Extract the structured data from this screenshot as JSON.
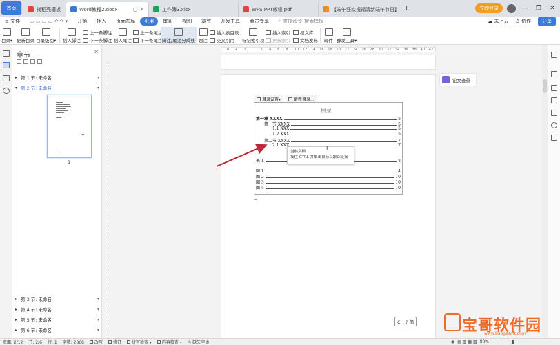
{
  "titlebar": {
    "home_label": "首页",
    "tabs": [
      {
        "label": "找稻壳模板",
        "icon_color": "#e0483a"
      },
      {
        "label": "Word教程2.docx",
        "icon_color": "#3d7bd9"
      },
      {
        "label": "工作簿3.xlsx",
        "icon_color": "#22a15c"
      },
      {
        "label": "WPS PPT教程.pdf",
        "icon_color": "#e0483a"
      },
      {
        "label": "【端午狂欢祝福清新端午节日】",
        "icon_color": "#f08a2a"
      }
    ],
    "new_tab": "+",
    "vip_label": "立即登录",
    "window_controls": [
      "—",
      "❐",
      "✕"
    ]
  },
  "menubar": {
    "file_label": "文件",
    "items": [
      "开始",
      "插入",
      "页面布局",
      "引用",
      "审阅",
      "视图",
      "章节",
      "开发工具",
      "会员专享"
    ],
    "active_item": "引用",
    "search_label": "查找命令",
    "search_template": "搜索模板",
    "right_items": [
      "未上云",
      "协作"
    ],
    "share_label": "分享"
  },
  "ribbon": {
    "toc_label": "目录▾",
    "update_toc": "更新目录",
    "toc_level": "目录级别▾",
    "insert_footnote": "插入脚注",
    "prev_footnote": "上一条脚注",
    "next_footnote": "下一条脚注",
    "insert_endnote": "插入尾注",
    "prev_endnote": "上一条尾注",
    "next_endnote": "下一条尾注",
    "footnote_sep": "脚注/尾注分隔线",
    "caption": "题注",
    "insert_table_toc": "插入表目录",
    "cross_ref": "交叉引用",
    "mark_index": "标记索引项",
    "insert_index": "插入索引",
    "update_index": "更新索引",
    "search_lib": "搜文库",
    "doc_publish": "文档发布",
    "mail": "邮件",
    "mass_tool": "群发工具▾"
  },
  "panel": {
    "title": "章节",
    "sections_top": [
      {
        "label": "第 1 节: 未命名",
        "selected": false
      },
      {
        "label": "第 2 节: 未命名",
        "selected": true
      }
    ],
    "page_number": "1",
    "sections_bottom": [
      {
        "label": "第 3 节: 未命名"
      },
      {
        "label": "第 4 节: 未命名"
      },
      {
        "label": "第 5 节: 未命名"
      },
      {
        "label": "第 6 节: 未命名"
      }
    ]
  },
  "ruler": {
    "ticks": [
      "6",
      "4",
      "2",
      "",
      "2",
      "4",
      "6",
      "8",
      "10",
      "12",
      "14",
      "16",
      "18",
      "20",
      "22",
      "24",
      "26",
      "28",
      "30",
      "32",
      "34",
      "36",
      "38",
      "40",
      "42"
    ]
  },
  "toc": {
    "toolbar_settings": "目录设置▾",
    "toolbar_update": "更新目录...",
    "title": "目录",
    "entries": [
      {
        "label": "第一章  XXXX",
        "page": "5",
        "bold": true,
        "indent": 0
      },
      {
        "label": "第一节  XXXX",
        "page": "5",
        "bold": false,
        "indent": 12
      },
      {
        "label": "1.1 XXX",
        "page": "5",
        "bold": false,
        "indent": 24
      },
      {
        "label": "1.2 XXX",
        "page": "5",
        "bold": false,
        "indent": 24
      },
      {
        "label": "第二节  XXXX",
        "page": "7",
        "bold": false,
        "indent": 12
      },
      {
        "label": "2.1 XXX",
        "page": "7",
        "bold": false,
        "indent": 24
      },
      {
        "label": "表 1",
        "page": "8",
        "bold": false,
        "indent": 0
      },
      {
        "label": "图 1",
        "page": "4",
        "bold": false,
        "indent": 0
      },
      {
        "label": "图 2",
        "page": "10",
        "bold": false,
        "indent": 0
      },
      {
        "label": "图 3",
        "page": "10",
        "bold": false,
        "indent": 0
      },
      {
        "label": "图 4",
        "page": "10",
        "bold": false,
        "indent": 0
      }
    ]
  },
  "tooltip": {
    "line1": "当前文档",
    "line2": "按住 CTRL 并单击鼠标以跟踪链接"
  },
  "ime_badge": "CH ♪ 简",
  "right_panel": {
    "essay_check": "论文查重"
  },
  "statusbar": {
    "page": "页面: 2/12",
    "section": "节: 2/6",
    "row": "行: 1",
    "words": "字数: 2868",
    "revise": "改写",
    "track": "修订",
    "spell": "拼写检查 ▾",
    "content_check": "内容检查 ▾",
    "missing_font": "缺失字体",
    "zoom": "80%"
  },
  "watermark": {
    "text": "宝哥软件园",
    "sub": "www.baogesoft.com"
  },
  "colors": {
    "accent": "#3d7bd9",
    "arrow": "#c0283a",
    "watermark": "#ef6b2a"
  }
}
